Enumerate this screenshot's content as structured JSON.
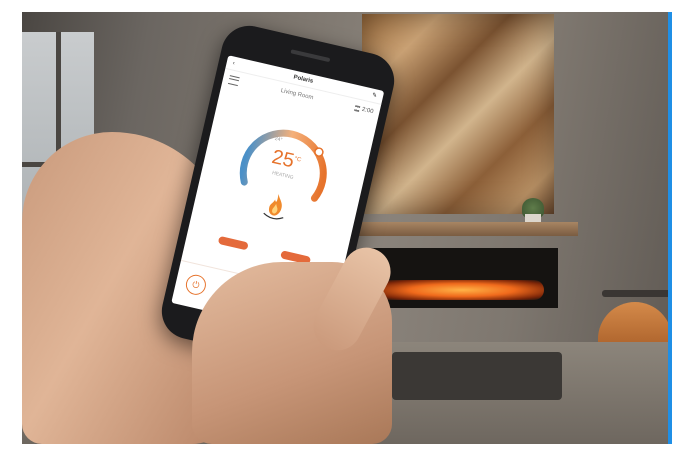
{
  "app": {
    "title": "Polaris",
    "room": "Living Room",
    "timer": "2:00",
    "set_temp": "24°",
    "current_temp": "25",
    "temp_unit": "°C",
    "mode": "HEATING"
  },
  "colors": {
    "accent": "#e6732c",
    "dial_cool": "#4a90c8",
    "dial_warm": "#f0883e"
  },
  "icons": {
    "back": "back-icon",
    "edit": "edit-icon",
    "menu": "menu-icon",
    "timer": "hourglass-icon",
    "flame": "flame-icon",
    "nav": [
      "power-icon",
      "flame-icon",
      "heat-icon",
      "timer-icon"
    ]
  }
}
